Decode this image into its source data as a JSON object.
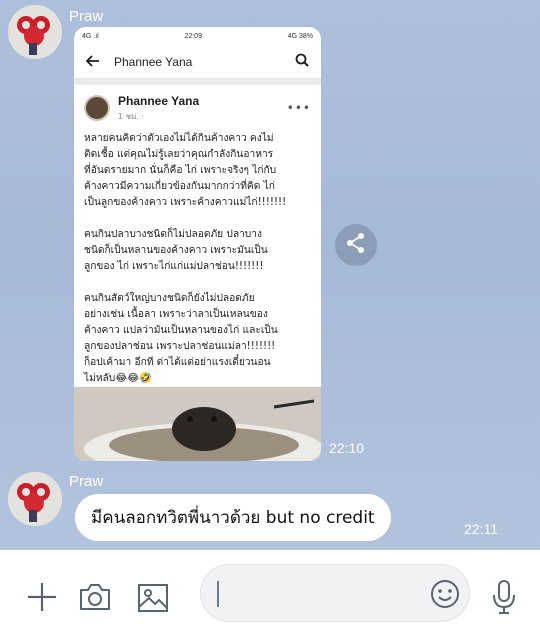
{
  "chat": {
    "messages": [
      {
        "sender": "Praw",
        "type": "image",
        "time": "22:10",
        "screenshot": {
          "status_left": "4G .ıl",
          "status_time": "22:09",
          "status_right": "4G 38%",
          "search_title": "Phannee Yana",
          "post_author": "Phannee Yana",
          "post_meta": "1 ชม. ·",
          "post_text": "หลายคนคิดว่าตัวเองไม่ได้กินค้างคาว คงไม่\nติดเชื้อ แต่คุณไม่รู้เลยว่าคุณกำลังกินอาหาร\nที่อันตรายมาก นั่นก็คือ ไก่ เพราะจริงๆ ไก่กับ\nค้างคาวมีความเกี่ยวข้องกันมากกว่าที่คิด ไก่\nเป็นลูกของค้างคาว เพราะค้างคาวแม่ไก่!!!!!!!\n\nคนกินปลาบางชนิดก็ไม่ปลอดภัย ปลาบาง\nชนิดก็เป็นหลานของค้างคาว เพราะมันเป็น\nลูกของ ไก่ เพราะไก่แก่แม่ปลาช่อน!!!!!!!\n\nคนกินสัตว์ใหญ่บางชนิดก็ยังไม่ปลอดภัย\nอย่างเช่น เนื้อลา เพราะว่าลาเป็นเหลนของ\nค้างคาว แปลว่ามันเป็นหลานของไก่ และเป็น\nลูกของปลาช่อน เพราะปลาช่อนแม่ลา!!!!!!!\nก็อปเค้ามา อีกที ด่าได้แต่อย่าแรงเดี๋ยวนอน\nไม่หลับ😂😂🤣"
        }
      },
      {
        "sender": "Praw",
        "type": "text",
        "text": "มีคนลอกทวิตพี่นาวด้วย but no credit",
        "time": "22:11"
      }
    ]
  },
  "input": {
    "placeholder": ""
  },
  "icons": {
    "add": "plus-icon",
    "camera": "camera-icon",
    "gallery": "image-icon",
    "emoji": "emoji-icon",
    "mic": "microphone-icon",
    "share": "share-icon"
  },
  "colors": {
    "background": "#a9bbd7",
    "bubble": "#ffffff",
    "input_bar": "#ffffff"
  }
}
